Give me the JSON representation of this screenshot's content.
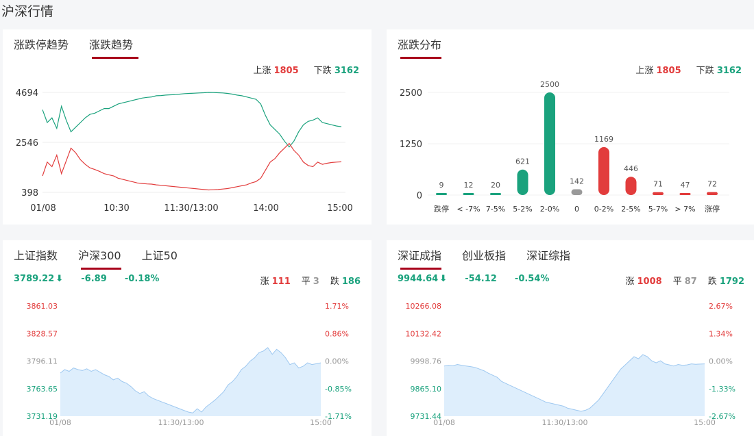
{
  "page": {
    "title": "沪深行情"
  },
  "trend_panel": {
    "tabs": [
      "涨跌停趋势",
      "涨跌趋势"
    ],
    "active_tab": 1,
    "up_label": "上涨",
    "up_count": "1805",
    "down_label": "下跌",
    "down_count": "3162"
  },
  "dist_panel": {
    "tabs": [
      "涨跌分布"
    ],
    "up_label": "上涨",
    "up_count": "1805",
    "down_label": "下跌",
    "down_count": "3162"
  },
  "hs300_panel": {
    "tabs": [
      "上证指数",
      "沪深300",
      "上证50"
    ],
    "active_tab": 1,
    "index_value": "3789.22",
    "arrow": "🡇",
    "change": "-6.89",
    "change_pct": "-0.18%",
    "up_label": "涨",
    "up": "111",
    "flat_label": "平",
    "flat": "3",
    "down_label": "跌",
    "down": "186"
  },
  "szcz_panel": {
    "tabs": [
      "深证成指",
      "创业板指",
      "深证综指"
    ],
    "active_tab": 0,
    "index_value": "9944.64",
    "arrow": "🡇",
    "change": "-54.12",
    "change_pct": "-0.54%",
    "up_label": "涨",
    "up": "1008",
    "flat_label": "平",
    "flat": "87",
    "down_label": "跌",
    "down": "1792"
  },
  "colors": {
    "up": "#e23c3c",
    "down": "#1aa27d",
    "flat": "#999999",
    "accent": "#a8001a",
    "area": "#deeefc",
    "area_line": "#9ec8f0"
  },
  "chart_data": [
    {
      "type": "line",
      "title": "涨跌趋势",
      "x_ticks": [
        "01/08",
        "10:30",
        "11:30/13:00",
        "14:00",
        "15:00"
      ],
      "y_ticks": [
        "4694",
        "2546",
        "398"
      ],
      "ylim": [
        398,
        4694
      ],
      "series": [
        {
          "name": "下跌",
          "color": "#1aa27d",
          "values": [
            3950,
            3400,
            3600,
            3150,
            4100,
            3500,
            3000,
            3200,
            3400,
            3600,
            3750,
            3800,
            3900,
            4000,
            4000,
            4100,
            4200,
            4250,
            4300,
            4350,
            4400,
            4450,
            4480,
            4500,
            4550,
            4560,
            4580,
            4590,
            4600,
            4620,
            4640,
            4650,
            4660,
            4670,
            4680,
            4694,
            4690,
            4680,
            4670,
            4650,
            4620,
            4580,
            4550,
            4500,
            4450,
            4400,
            4200,
            3700,
            3300,
            3100,
            2900,
            2600,
            2350,
            2600,
            3000,
            3300,
            3450,
            3500,
            3600,
            3400,
            3350,
            3300,
            3250,
            3220
          ]
        },
        {
          "name": "上涨",
          "color": "#e23c3c",
          "values": [
            1100,
            1700,
            1500,
            2000,
            1200,
            1750,
            2300,
            2100,
            1800,
            1600,
            1450,
            1380,
            1300,
            1200,
            1150,
            1100,
            1000,
            950,
            900,
            850,
            800,
            780,
            760,
            750,
            720,
            700,
            680,
            660,
            640,
            620,
            600,
            580,
            560,
            540,
            520,
            500,
            510,
            520,
            540,
            560,
            600,
            640,
            680,
            720,
            800,
            860,
            1000,
            1350,
            1700,
            1850,
            2100,
            2300,
            2500,
            2200,
            2000,
            1700,
            1550,
            1500,
            1700,
            1600,
            1650,
            1680,
            1700,
            1710
          ]
        }
      ]
    },
    {
      "type": "bar",
      "title": "涨跌分布",
      "categories": [
        "跌停",
        "< -7%",
        "7-5%",
        "5-2%",
        "2-0%",
        "0",
        "0-2%",
        "2-5%",
        "5-7%",
        "> 7%",
        "涨停"
      ],
      "values": [
        9,
        12,
        20,
        621,
        2500,
        142,
        1169,
        446,
        71,
        47,
        72
      ],
      "bar_colors": [
        "#1aa27d",
        "#1aa27d",
        "#1aa27d",
        "#1aa27d",
        "#1aa27d",
        "#999999",
        "#e23c3c",
        "#e23c3c",
        "#e23c3c",
        "#e23c3c",
        "#e23c3c"
      ],
      "y_ticks": [
        "2500",
        "1250",
        "0"
      ],
      "ylim": [
        0,
        2500
      ]
    },
    {
      "type": "area",
      "title": "沪深300",
      "x_ticks": [
        "01/08",
        "11:30/13:00",
        "15:00"
      ],
      "y_ticks_left": [
        "3861.03",
        "3828.57",
        "3796.11",
        "3763.65",
        "3731.19"
      ],
      "y_ticks_right": [
        "1.71%",
        "0.86%",
        "0.00%",
        "-0.85%",
        "-1.71%"
      ],
      "ylim": [
        3731.19,
        3861.03
      ],
      "values": [
        3782,
        3786,
        3784,
        3788,
        3786,
        3785,
        3787,
        3784,
        3786,
        3783,
        3780,
        3778,
        3774,
        3776,
        3772,
        3770,
        3766,
        3761,
        3758,
        3760,
        3755,
        3752,
        3750,
        3748,
        3746,
        3744,
        3742,
        3740,
        3738,
        3736,
        3735,
        3740,
        3736,
        3742,
        3746,
        3750,
        3755,
        3760,
        3768,
        3772,
        3778,
        3786,
        3790,
        3796,
        3800,
        3806,
        3808,
        3812,
        3804,
        3810,
        3806,
        3800,
        3792,
        3794,
        3788,
        3790,
        3794,
        3792,
        3793,
        3794
      ]
    },
    {
      "type": "area",
      "title": "深证成指",
      "x_ticks": [
        "01/08",
        "11:30/13:00",
        "15:00"
      ],
      "y_ticks_left": [
        "10266.08",
        "10132.42",
        "9998.76",
        "9865.10",
        "9731.44"
      ],
      "y_ticks_right": [
        "2.67%",
        "1.34%",
        "0.00%",
        "-1.33%",
        "-2.67%"
      ],
      "ylim": [
        9731.44,
        10266.08
      ],
      "values": [
        9975,
        9978,
        9976,
        9982,
        9978,
        9975,
        9972,
        9968,
        9960,
        9952,
        9940,
        9930,
        9920,
        9900,
        9890,
        9880,
        9870,
        9860,
        9850,
        9840,
        9830,
        9820,
        9810,
        9800,
        9795,
        9790,
        9785,
        9780,
        9770,
        9765,
        9760,
        9755,
        9760,
        9770,
        9790,
        9810,
        9840,
        9870,
        9900,
        9930,
        9960,
        9980,
        10000,
        10020,
        10010,
        10030,
        10020,
        10000,
        9990,
        10000,
        9985,
        9980,
        9975,
        9982,
        9978,
        9980,
        9985,
        9983,
        9984,
        9985
      ]
    }
  ]
}
